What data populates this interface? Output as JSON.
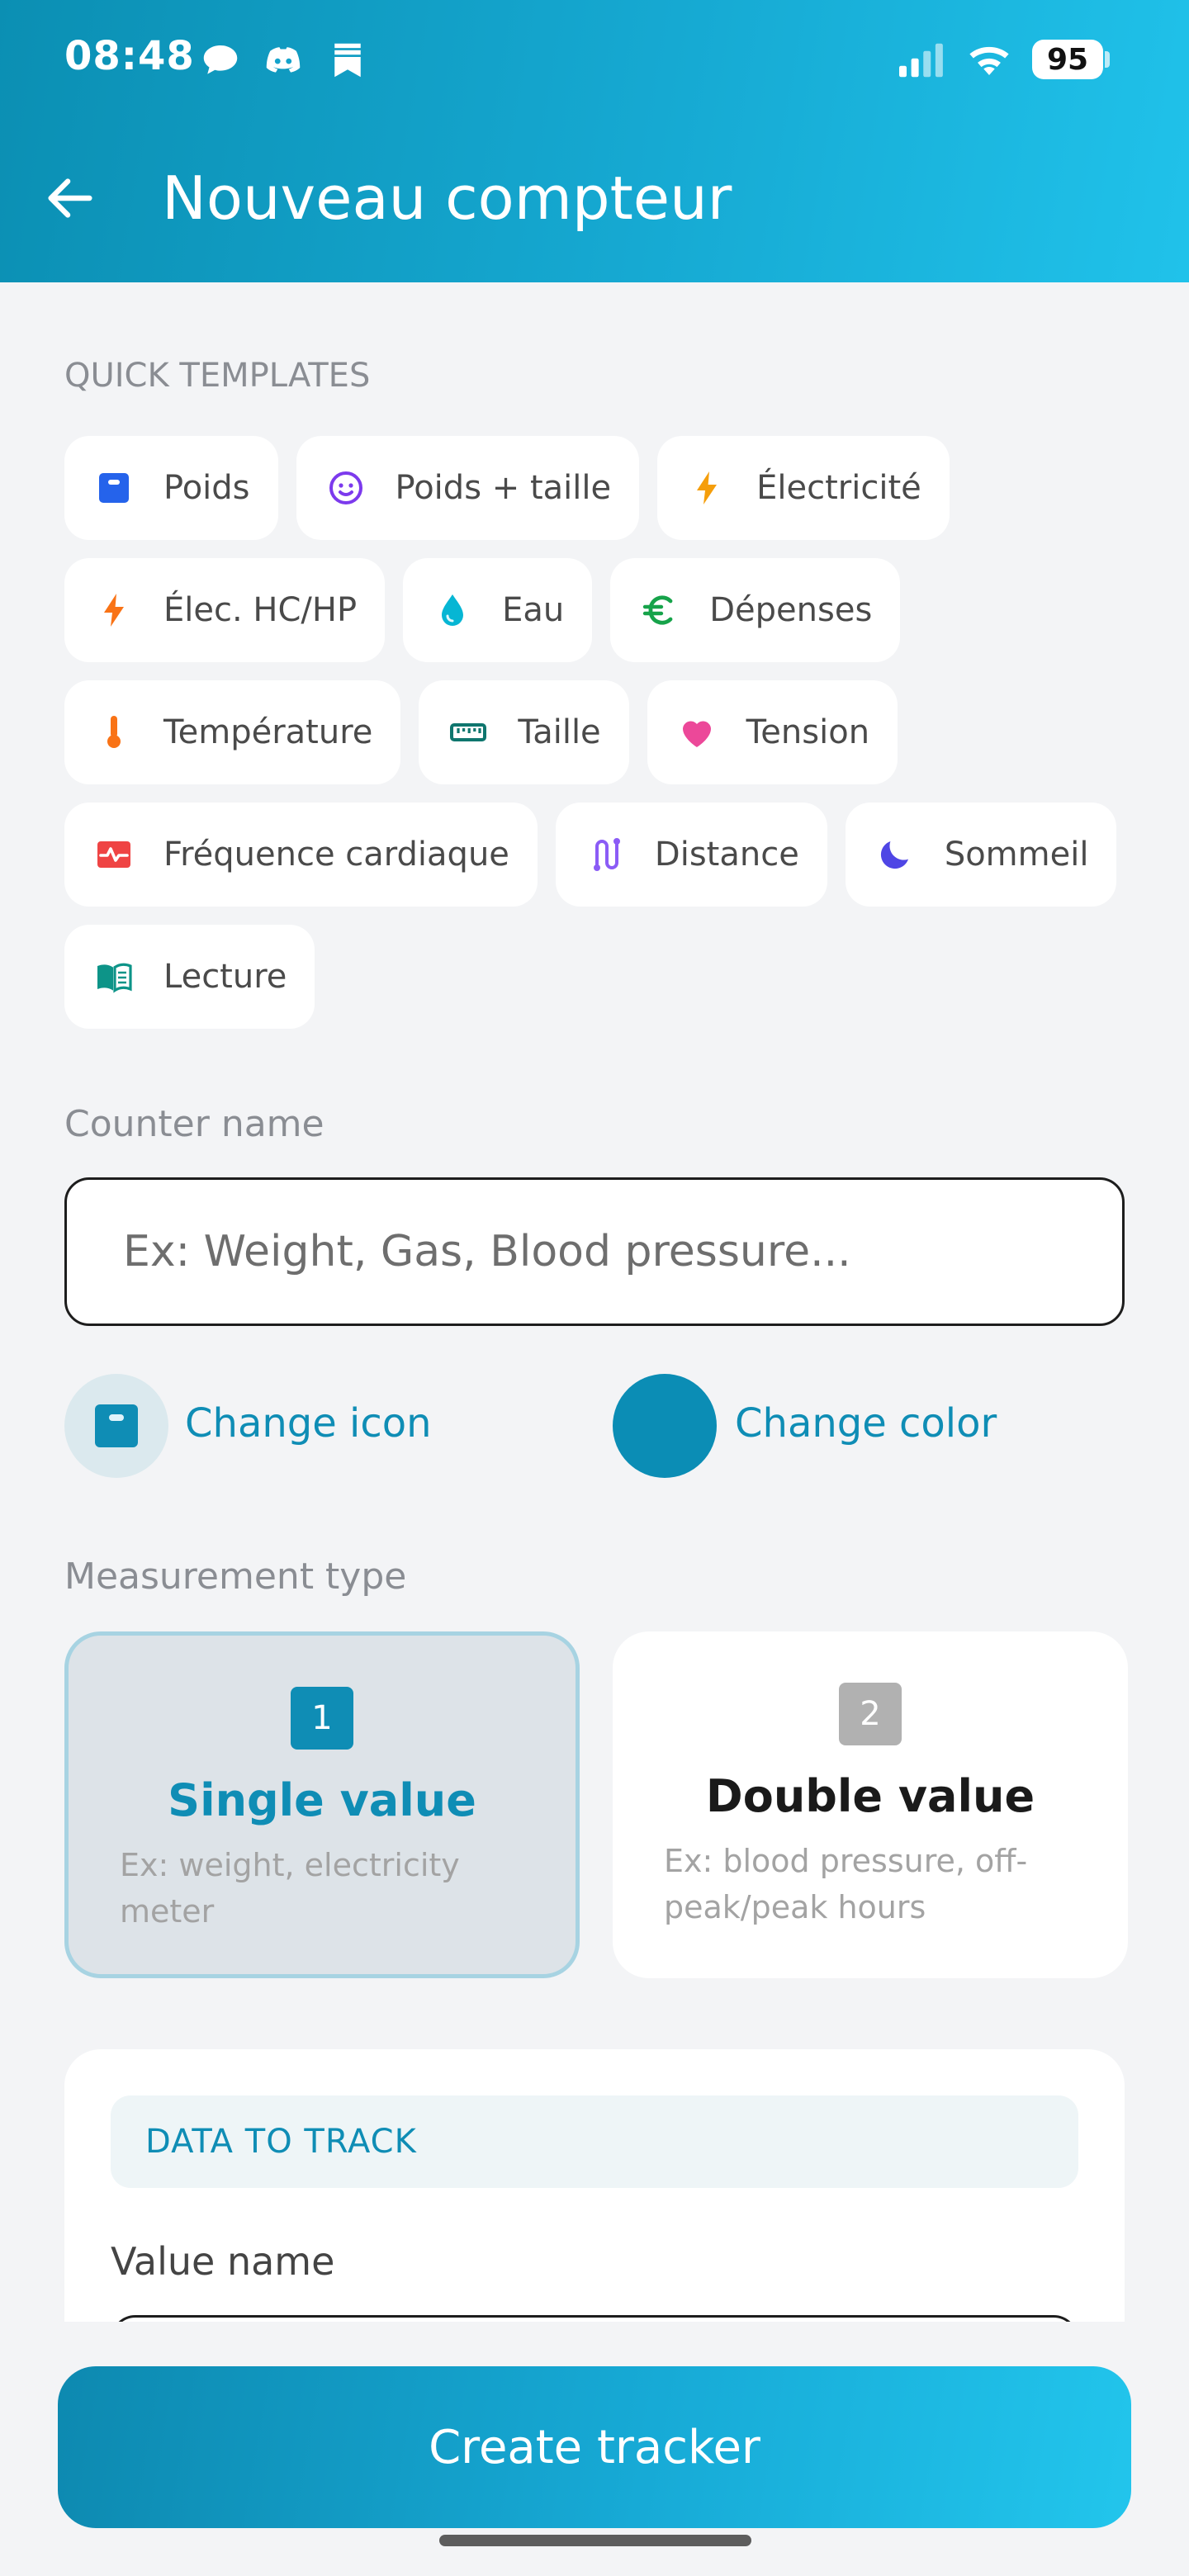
{
  "status_bar": {
    "time": "08:48",
    "battery": "95"
  },
  "header": {
    "title": "Nouveau compteur"
  },
  "templates": {
    "section_label": "QUICK TEMPLATES",
    "rows": [
      [
        {
          "label": "Poids",
          "icon": "scale-icon",
          "color": "#2563eb"
        },
        {
          "label": "Poids + taille",
          "icon": "smiley-icon",
          "color": "#7c3aed"
        },
        {
          "label": "Électricité",
          "icon": "lightning-icon",
          "color": "#f59e0b"
        }
      ],
      [
        {
          "label": "Élec. HC/HP",
          "icon": "lightning-icon",
          "color": "#f97316"
        },
        {
          "label": "Eau",
          "icon": "water-drop-icon",
          "color": "#06b6d4"
        },
        {
          "label": "Dépenses",
          "icon": "euro-icon",
          "color": "#16a34a"
        }
      ],
      [
        {
          "label": "Température",
          "icon": "thermometer-icon",
          "color": "#f97316"
        },
        {
          "label": "Taille",
          "icon": "ruler-icon",
          "color": "#0f766e"
        },
        {
          "label": "Tension",
          "icon": "heart-icon",
          "color": "#ec4899"
        }
      ],
      [
        {
          "label": "Fréquence cardiaque",
          "icon": "heartbeat-icon",
          "color": "#ef4444"
        },
        {
          "label": "Distance",
          "icon": "route-icon",
          "color": "#8b5cf6"
        },
        {
          "label": "Sommeil",
          "icon": "moon-icon",
          "color": "#4f46e5"
        }
      ],
      [
        {
          "label": "Lecture",
          "icon": "book-icon",
          "color": "#0d9488"
        }
      ]
    ]
  },
  "counter": {
    "label": "Counter name",
    "placeholder": "Ex: Weight, Gas, Blood pressure...",
    "change_icon": "Change icon",
    "change_color": "Change color",
    "accent_color": "#0f8db5"
  },
  "measurement": {
    "label": "Measurement type",
    "options": [
      {
        "number": "1",
        "title": "Single value",
        "desc": "Ex: weight, electricity meter",
        "selected": true
      },
      {
        "number": "2",
        "title": "Double value",
        "desc": "Ex: blood pressure, off-peak/peak hours",
        "selected": false
      }
    ]
  },
  "data_to_track": {
    "header": "DATA TO TRACK",
    "value_name_label": "Value name"
  },
  "footer": {
    "create_button": "Create tracker"
  }
}
